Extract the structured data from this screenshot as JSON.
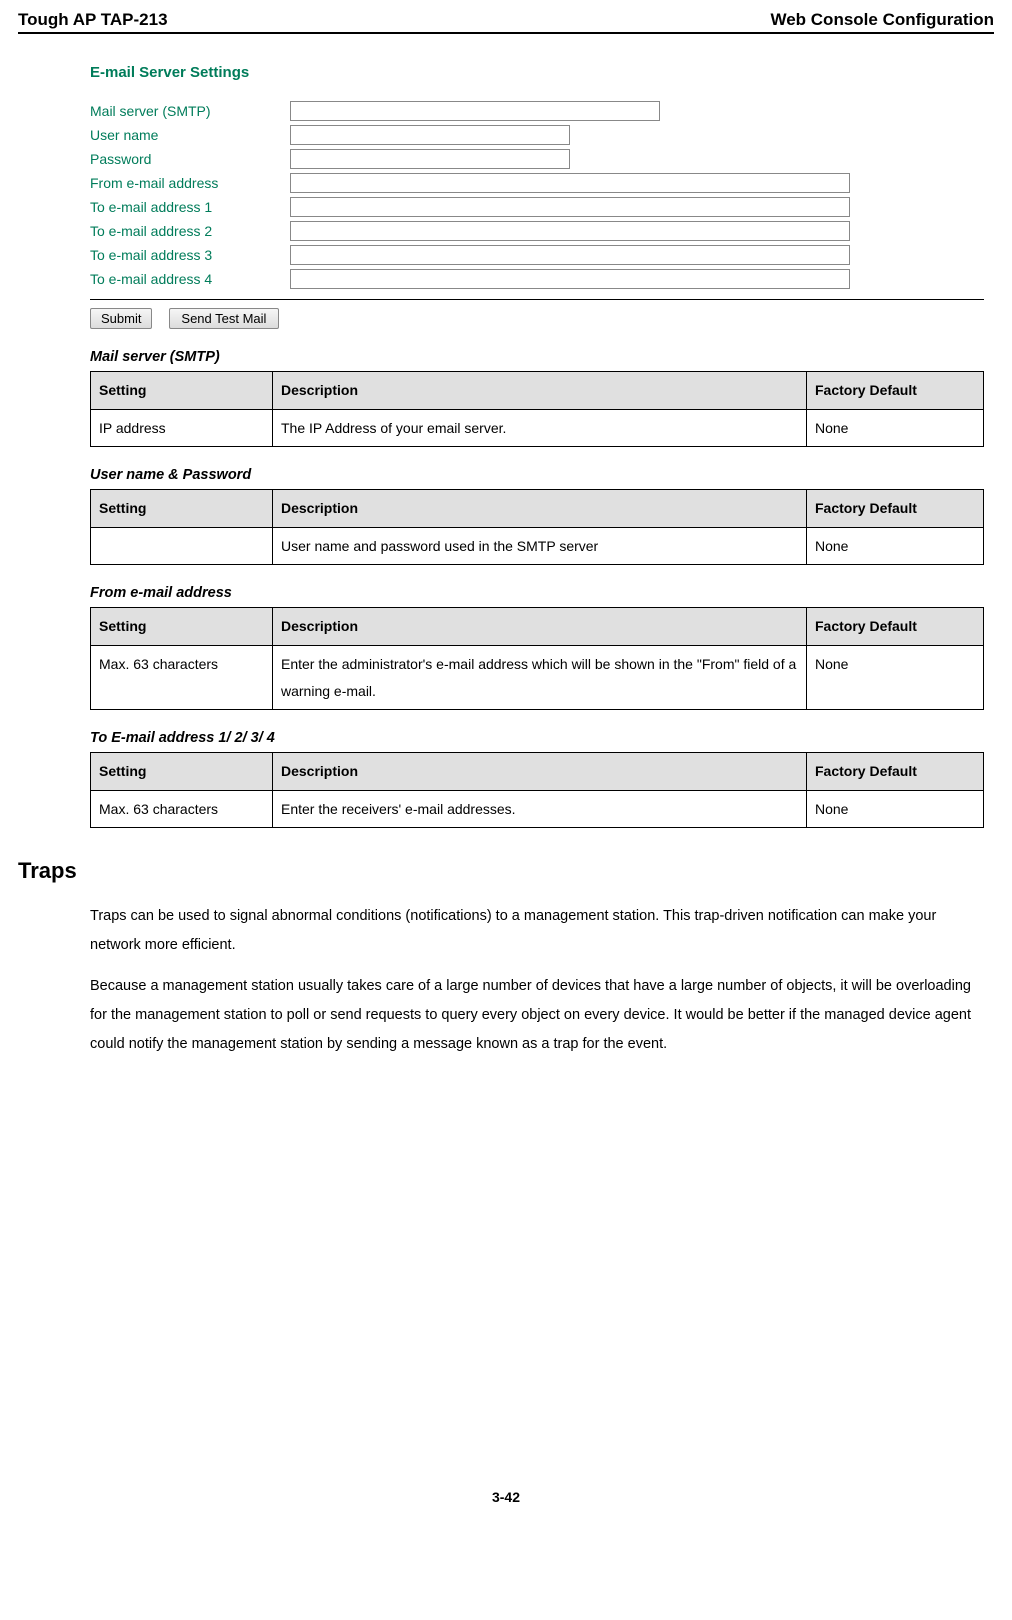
{
  "header": {
    "left": "Tough AP TAP-213",
    "right": "Web Console Configuration"
  },
  "form": {
    "title": "E-mail Server Settings",
    "fields": {
      "mail_server": "Mail server (SMTP)",
      "user_name": "User name",
      "password": "Password",
      "from": "From e-mail address",
      "to1": "To e-mail address 1",
      "to2": "To e-mail address 2",
      "to3": "To e-mail address 3",
      "to4": "To e-mail address 4"
    },
    "buttons": {
      "submit": "Submit",
      "test": "Send Test Mail"
    }
  },
  "tables": {
    "headers": {
      "setting": "Setting",
      "description": "Description",
      "default": "Factory Default"
    },
    "t1": {
      "title": "Mail server (SMTP)",
      "setting": "IP address",
      "desc": "The IP Address of your email server.",
      "def": "None"
    },
    "t2": {
      "title": "User name & Password",
      "setting": "",
      "desc": "User name and password used in the SMTP server",
      "def": "None"
    },
    "t3": {
      "title": "From e-mail address",
      "setting": "Max. 63 characters",
      "desc": "Enter the administrator's e-mail address which will be shown in the \"From\" field of a warning e-mail.",
      "def": "None"
    },
    "t4": {
      "title": "To E-mail address 1/ 2/ 3/ 4",
      "setting": "Max. 63 characters",
      "desc": "Enter the receivers' e-mail addresses.",
      "def": "None"
    }
  },
  "traps": {
    "heading": "Traps",
    "p1": "Traps can be used to signal abnormal conditions (notifications) to a management station. This trap-driven notification can make your network more efficient.",
    "p2": "Because a management station usually takes care of a large number of devices that have a large number of objects, it will be overloading for the management station to poll or send requests to query every object on every device. It would be better if the managed device agent could notify the management station by sending a message known as a trap for the event."
  },
  "page_number": "3-42"
}
